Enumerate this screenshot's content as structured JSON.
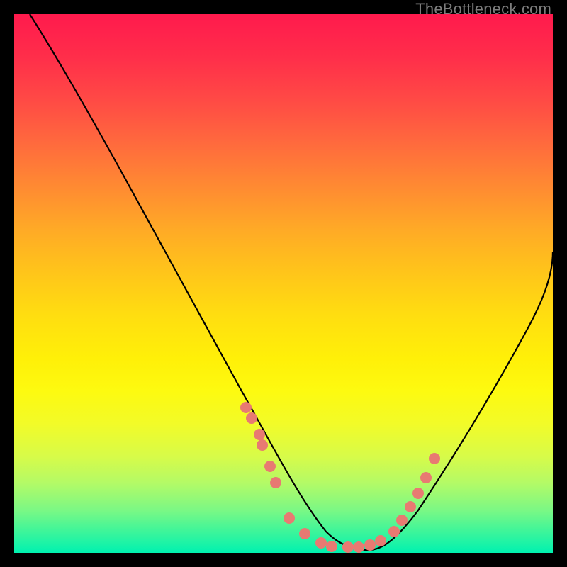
{
  "watermark": {
    "text": "TheBottleneck.com"
  },
  "chart_data": {
    "type": "line",
    "title": "",
    "xlabel": "",
    "ylabel": "",
    "xlim": [
      0,
      100
    ],
    "ylim": [
      0,
      100
    ],
    "series": [
      {
        "name": "curve",
        "x": [
          3,
          8,
          14,
          20,
          26,
          32,
          38,
          44,
          48,
          52,
          56,
          60,
          63,
          66,
          70,
          76,
          82,
          88,
          94,
          100
        ],
        "y": [
          100,
          92,
          83,
          73,
          62,
          51,
          40,
          28,
          20,
          13,
          7,
          3,
          1,
          1,
          3,
          9,
          18,
          29,
          42,
          56
        ]
      }
    ],
    "markers": {
      "left_cluster": [
        [
          43,
          27
        ],
        [
          44,
          25
        ],
        [
          45.5,
          22
        ],
        [
          46,
          20
        ],
        [
          47.5,
          16
        ],
        [
          48.5,
          13
        ]
      ],
      "bottom_cluster": [
        [
          51,
          6.5
        ],
        [
          54,
          3.5
        ],
        [
          57,
          1.8
        ],
        [
          59,
          1.2
        ],
        [
          62,
          1.0
        ],
        [
          64,
          1.1
        ],
        [
          66,
          1.4
        ],
        [
          68,
          2.2
        ]
      ],
      "right_cluster": [
        [
          70.5,
          4
        ],
        [
          72,
          6
        ],
        [
          73.5,
          8.5
        ],
        [
          75,
          11
        ],
        [
          76.5,
          14
        ],
        [
          78,
          17.5
        ]
      ]
    },
    "marker_color": "#e87a72",
    "curve_color": "#000000",
    "gradient": [
      "#ff1a4d",
      "#ff4a45",
      "#ff8a32",
      "#ffc51a",
      "#fff008",
      "#d8fb48",
      "#3ef59a",
      "#00f2b0"
    ]
  }
}
